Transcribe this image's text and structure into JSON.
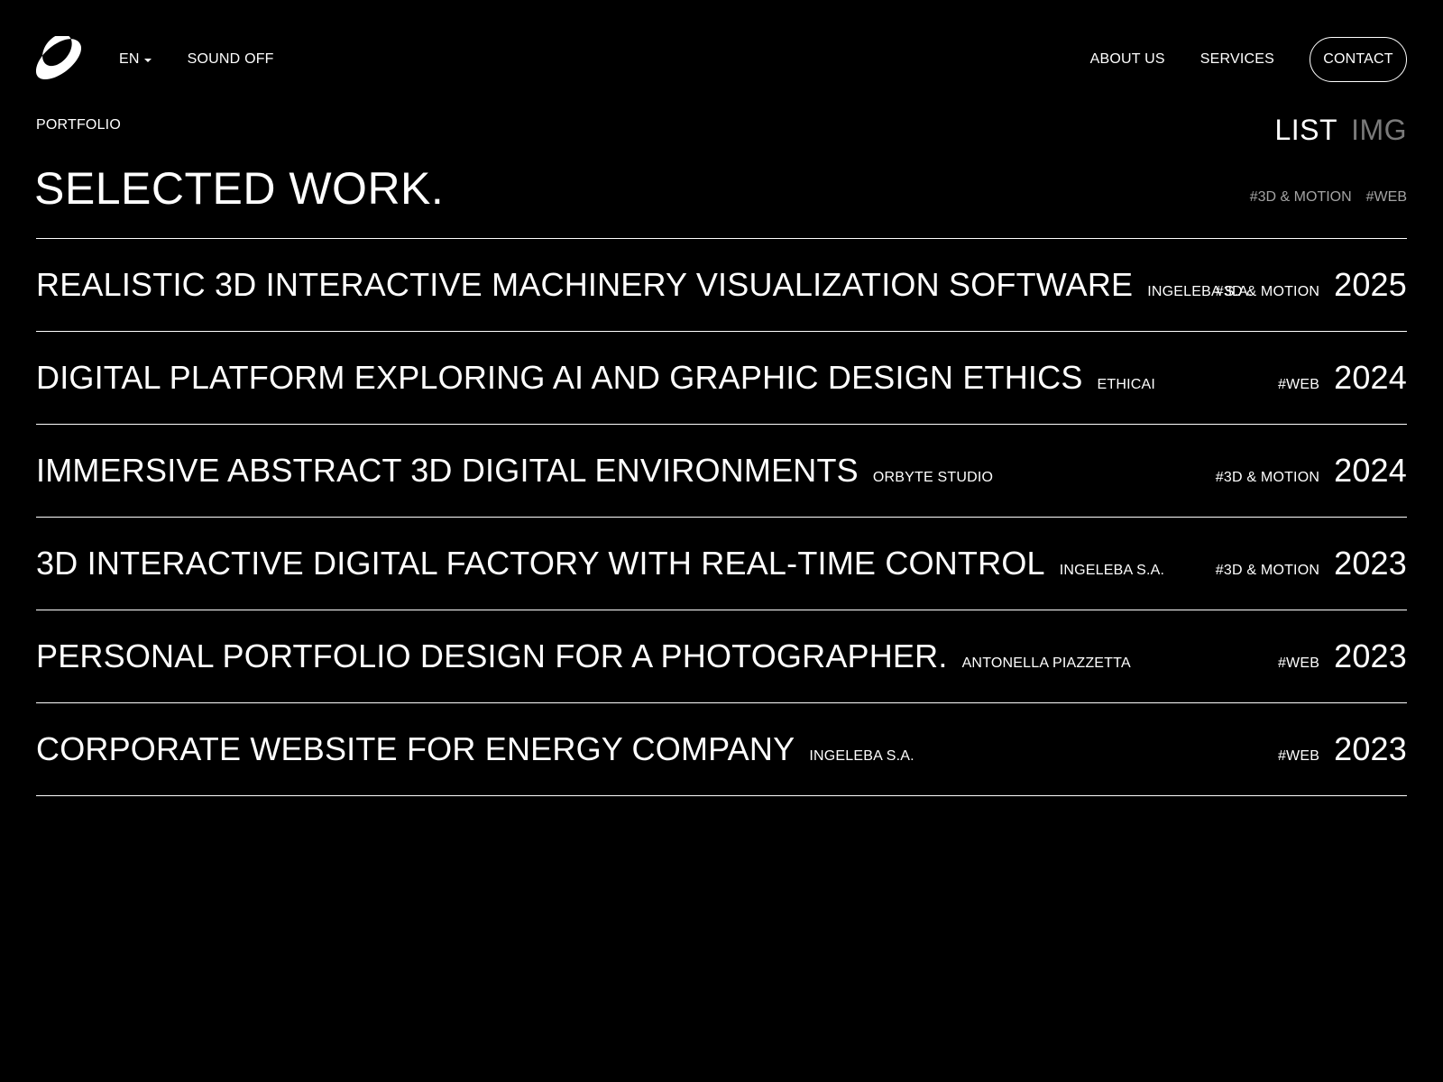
{
  "header": {
    "language": "EN",
    "sound_toggle": "SOUND OFF",
    "nav": {
      "about": "ABOUT US",
      "services": "SERVICES",
      "contact": "CONTACT"
    },
    "icons": {
      "logo": "logo-mark",
      "language_caret": "chevron-down-icon"
    }
  },
  "page": {
    "eyebrow": "PORTFOLIO",
    "title": "SELECTED WORK.",
    "view_toggle": {
      "list": "LIST",
      "img": "IMG"
    },
    "filters": [
      "#3D & MOTION",
      "#WEB"
    ]
  },
  "projects": [
    {
      "title": "REALISTIC 3D INTERACTIVE MACHINERY VISUALIZATION SOFTWARE",
      "client": "INGELEBA S.A.",
      "tag": "#3D & MOTION",
      "year": "2025"
    },
    {
      "title": "DIGITAL PLATFORM EXPLORING AI AND GRAPHIC DESIGN ETHICS",
      "client": "ETHICAI",
      "tag": "#WEB",
      "year": "2024"
    },
    {
      "title": "IMMERSIVE ABSTRACT 3D DIGITAL ENVIRONMENTS",
      "client": "ORBYTE STUDIO",
      "tag": "#3D & MOTION",
      "year": "2024"
    },
    {
      "title": "3D INTERACTIVE DIGITAL FACTORY WITH REAL-TIME CONTROL",
      "client": "INGELEBA S.A.",
      "tag": "#3D & MOTION",
      "year": "2023"
    },
    {
      "title": "PERSONAL PORTFOLIO DESIGN FOR A PHOTOGRAPHER.",
      "client": "ANTONELLA PIAZZETTA",
      "tag": "#WEB",
      "year": "2023"
    },
    {
      "title": "CORPORATE WEBSITE FOR ENERGY COMPANY",
      "client": "INGELEBA S.A.",
      "tag": "#WEB",
      "year": "2023"
    }
  ],
  "colors": {
    "background": "#000000",
    "text": "#ffffff",
    "muted": "#7a7a7a"
  }
}
